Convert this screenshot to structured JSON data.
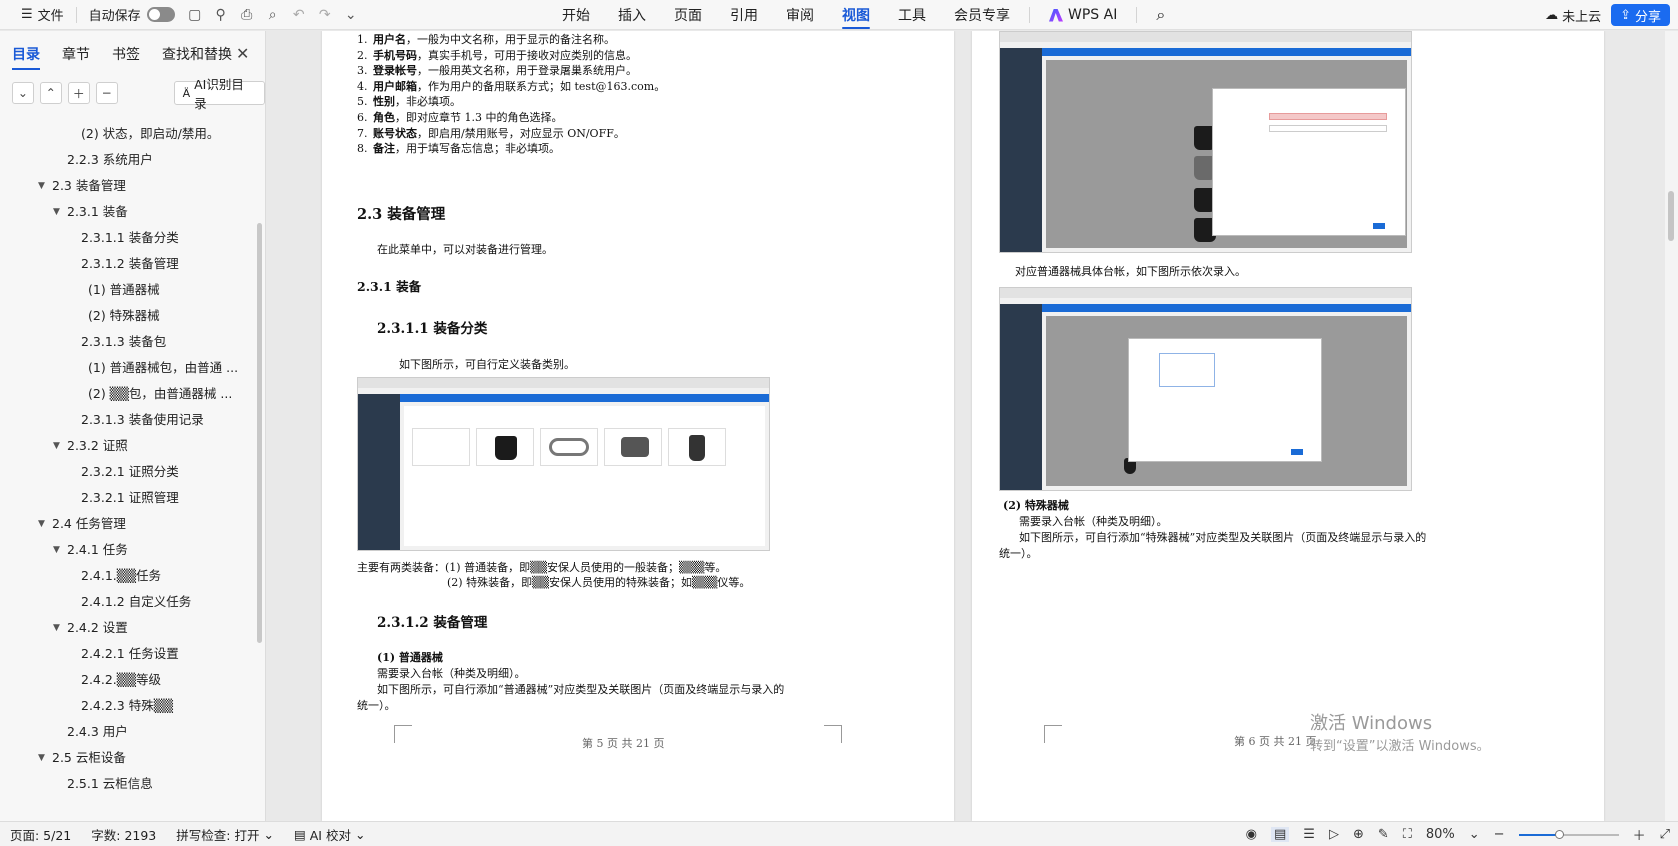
{
  "toolbar": {
    "menu_label": "文件",
    "autosave_label": "自动保存",
    "tabs": [
      "开始",
      "插入",
      "页面",
      "引用",
      "审阅",
      "视图",
      "工具",
      "会员专享"
    ],
    "active_tab": "视图",
    "wps_ai_label": "WPS AI",
    "cloud_label": "未上云",
    "share_label": "分享"
  },
  "sidebar": {
    "tabs": [
      "目录",
      "章节",
      "书签",
      "查找和替换"
    ],
    "active_tab": "目录",
    "ai_toc_label": "AI识别目录",
    "toc": [
      {
        "text": "(2) 状态，即启动/禁用。",
        "level": 4,
        "arrow": ""
      },
      {
        "text": "2.2.3 系统用户",
        "level": 3,
        "arrow": ""
      },
      {
        "text": "2.3 装备管理",
        "level": 2,
        "arrow": "▼"
      },
      {
        "text": "2.3.1 装备",
        "level": 3,
        "arrow": "▼"
      },
      {
        "text": "2.3.1.1 装备分类",
        "level": 4,
        "arrow": ""
      },
      {
        "text": "2.3.1.2 装备管理",
        "level": 4,
        "arrow": ""
      },
      {
        "text": "(1) 普通器械",
        "level": 5,
        "arrow": ""
      },
      {
        "text": "(2) 特殊器械",
        "level": 5,
        "arrow": ""
      },
      {
        "text": "2.3.1.3 装备包",
        "level": 4,
        "arrow": ""
      },
      {
        "text": "(1) 普通器械包，由普通 ...",
        "level": 5,
        "arrow": ""
      },
      {
        "text": "(2) ▒▒包，由普通器械 ...",
        "level": 5,
        "arrow": ""
      },
      {
        "text": "2.3.1.3 装备使用记录",
        "level": 4,
        "arrow": ""
      },
      {
        "text": "2.3.2 证照",
        "level": 3,
        "arrow": "▼"
      },
      {
        "text": "2.3.2.1 证照分类",
        "level": 4,
        "arrow": ""
      },
      {
        "text": "2.3.2.1 证照管理",
        "level": 4,
        "arrow": ""
      },
      {
        "text": "2.4 任务管理",
        "level": 2,
        "arrow": "▼"
      },
      {
        "text": "2.4.1 任务",
        "level": 3,
        "arrow": "▼"
      },
      {
        "text": "2.4.1.▒▒任务",
        "level": 4,
        "arrow": ""
      },
      {
        "text": "2.4.1.2 自定义任务",
        "level": 4,
        "arrow": ""
      },
      {
        "text": "2.4.2 设置",
        "level": 3,
        "arrow": "▼"
      },
      {
        "text": "2.4.2.1 任务设置",
        "level": 4,
        "arrow": ""
      },
      {
        "text": "2.4.2.▒▒等级",
        "level": 4,
        "arrow": ""
      },
      {
        "text": "2.4.2.3 特殊▒▒",
        "level": 4,
        "arrow": ""
      },
      {
        "text": "2.4.3 用户",
        "level": 3,
        "arrow": ""
      },
      {
        "text": "2.5 云柜设备",
        "level": 2,
        "arrow": "▼"
      },
      {
        "text": "2.5.1 云柜信息",
        "level": 3,
        "arrow": ""
      }
    ]
  },
  "page5": {
    "list": [
      {
        "num": "1.",
        "bold": "用户名",
        "rest": "，一般为中文名称，用于显示的备注名称。"
      },
      {
        "num": "2.",
        "bold": "手机号码",
        "rest": "，真实手机号，可用于接收对应类别的信息。"
      },
      {
        "num": "3.",
        "bold": "登录帐号",
        "rest": "，一般用英文名称，用于登录屠巢系统用户。"
      },
      {
        "num": "4.",
        "bold": "用户邮箱",
        "rest": "，作为用户的备用联系方式；如 test@163.com。"
      },
      {
        "num": "5.",
        "bold": "性别",
        "rest": "，非必填项。"
      },
      {
        "num": "6.",
        "bold": "角色",
        "rest": "，即对应章节 1.3 中的角色选择。"
      },
      {
        "num": "7.",
        "bold": "账号状态",
        "rest": "，即启用/禁用账号，对应显示 ON/OFF。"
      },
      {
        "num": "8.",
        "bold": "备注",
        "rest": "，用于填写备忘信息；非必填项。"
      }
    ],
    "h_23": "2.3  装备管理",
    "p_23": "在此菜单中，可以对装备进行管理。",
    "h_231": "2.3.1  装备",
    "h_2311": "2.3.1.1  装备分类",
    "p_2311": "如下图所示，可自行定义装备类别。",
    "p_types1": "主要有两类装备：(1) 普通装备，即▒▒安保人员使用的一般装备；▒▒▒等。",
    "p_types2": "(2) 特殊装备，即▒▒安保人员使用的特殊装备；如▒▒▒仪等。",
    "h_2312": "2.3.1.2  装备管理",
    "h_normal": "(1) 普通器械",
    "p_normal1": "需要录入台帐（种类及明细）。",
    "p_normal2": "如下图所示，可自行添加“普通器械”对应类型及关联图片（页面及终端显示与录入的",
    "p_normal3": "统一）。",
    "footer": "第 5 页 共 21 页"
  },
  "page6": {
    "p_caption": "对应普通器械具体台帐，如下图所示依次录入。",
    "h_special": "(2) 特殊器械",
    "p_special1": "需要录入台帐（种类及明细）。",
    "p_special2": "如下图所示，可自行添加“特殊器械”对应类型及关联图片（页面及终端显示与录入的",
    "p_special3": "统一）。",
    "footer": "第 6 页 共 21 页"
  },
  "watermark": {
    "line1": "激活 Windows",
    "line2": "转到“设置”以激活 Windows。"
  },
  "status": {
    "page": "页面: 5/21",
    "words": "字数: 2193",
    "spell": "拼写检查: 打开",
    "ai_check": "AI 校对",
    "zoom": "80%"
  }
}
